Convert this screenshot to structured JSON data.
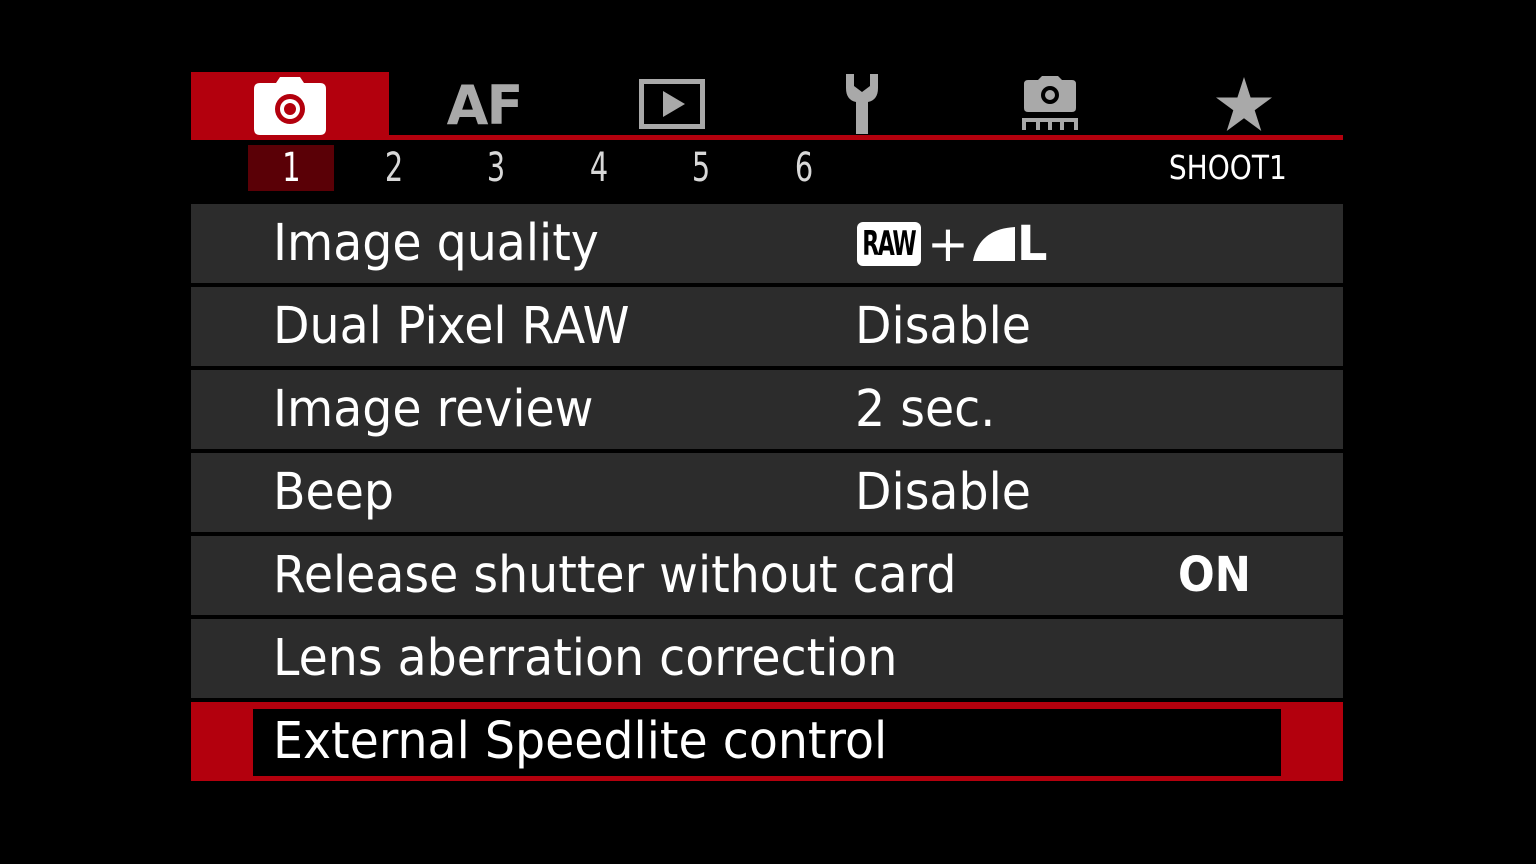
{
  "tabs": [
    {
      "name": "camera-icon",
      "active": true
    },
    {
      "name": "af",
      "label": "AF",
      "active": false
    },
    {
      "name": "playback-icon",
      "active": false
    },
    {
      "name": "wrench-icon",
      "active": false
    },
    {
      "name": "custom-function-icon",
      "active": false
    },
    {
      "name": "star-icon",
      "active": false
    }
  ],
  "pages": [
    "1",
    "2",
    "3",
    "4",
    "5",
    "6"
  ],
  "active_page": "1",
  "page_label": "SHOOT1",
  "rows": [
    {
      "label": "Image quality",
      "value_type": "quality",
      "raw": "RAW",
      "plus": "+",
      "size": "L"
    },
    {
      "label": "Dual Pixel RAW",
      "value": "Disable"
    },
    {
      "label": "Image review",
      "value": "2 sec."
    },
    {
      "label": "Beep",
      "value": "Disable"
    },
    {
      "label": "Release shutter without card",
      "value": "ON"
    },
    {
      "label": "Lens aberration correction",
      "value": ""
    },
    {
      "label": "External Speedlite control",
      "value": "",
      "selected": true
    }
  ],
  "colors": {
    "accent_red": "#b3000d",
    "active_page_bg": "#5a0006",
    "row_bg": "#2c2c2c",
    "icon_gray": "#a9a9a9",
    "background": "#000000"
  }
}
